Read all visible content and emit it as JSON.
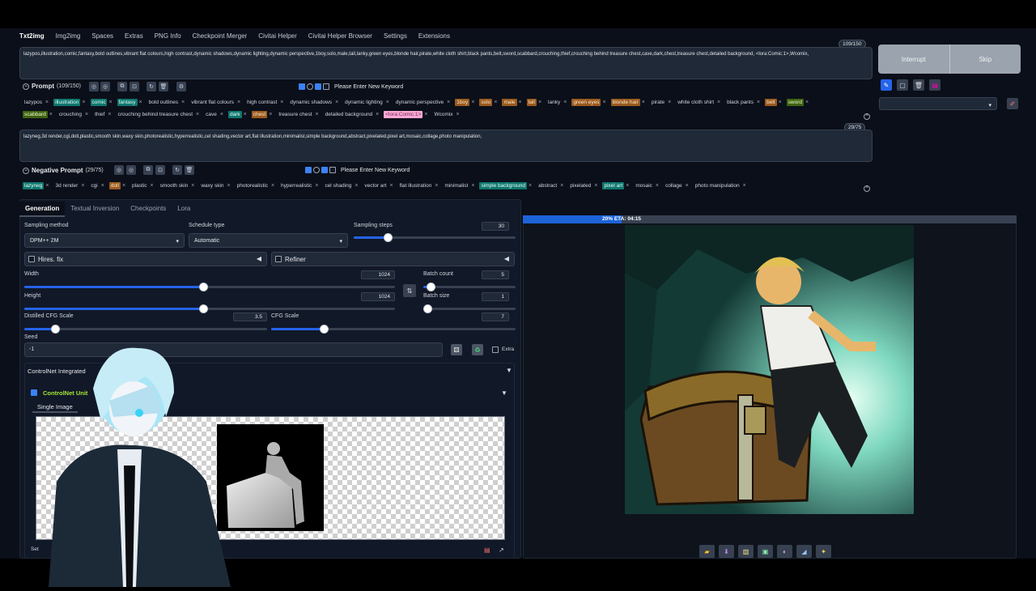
{
  "tabs": [
    "Txt2img",
    "Img2img",
    "Spaces",
    "Extras",
    "PNG Info",
    "Checkpoint Merger",
    "Civitai Helper",
    "Civitai Helper Browser",
    "Settings",
    "Extensions"
  ],
  "prompt": {
    "text": "lazypos,illustration,comic,fantasy,bold outlines,vibrant flat colours,high contrast,dynamic shadows,dynamic lighting,dynamic perspective,1boy,solo,male,tall,lanky,green eyes,blonde hair,pirate,white cloth shirt,black pants,belt,sword,scabbard,crouching,thief,crouching behind treasure chest,cave,dark,chest,treasure chest,detailed background, <lora:Comic:1>,Wcomix,",
    "counter": "109/150",
    "label": "Prompt",
    "count": "(109/150)",
    "keyword_label": "Please Enter New Keyword"
  },
  "prompt_tags": [
    {
      "t": "lazypos",
      "c": "plain"
    },
    {
      "t": "illustration",
      "c": "teal"
    },
    {
      "t": "comic",
      "c": "teal"
    },
    {
      "t": "fantasy",
      "c": "teal"
    },
    {
      "t": "bold outlines",
      "c": "plain"
    },
    {
      "t": "vibrant flat colours",
      "c": "plain"
    },
    {
      "t": "high contrast",
      "c": "plain"
    },
    {
      "t": "dynamic shadows",
      "c": "plain"
    },
    {
      "t": "dynamic lighting",
      "c": "plain"
    },
    {
      "t": "dynamic perspective",
      "c": "plain"
    },
    {
      "t": "1boy",
      "c": "orange"
    },
    {
      "t": "solo",
      "c": "orange"
    },
    {
      "t": "male",
      "c": "orange"
    },
    {
      "t": "tall",
      "c": "orange"
    },
    {
      "t": "lanky",
      "c": "plain"
    },
    {
      "t": "green eyes",
      "c": "orange"
    },
    {
      "t": "blonde hair",
      "c": "orange"
    },
    {
      "t": "pirate",
      "c": "plain"
    },
    {
      "t": "white cloth shirt",
      "c": "plain"
    },
    {
      "t": "black pants",
      "c": "plain"
    },
    {
      "t": "belt",
      "c": "orange"
    },
    {
      "t": "sword",
      "c": "green"
    }
  ],
  "prompt_tags2": [
    {
      "t": "scabbard",
      "c": "green"
    },
    {
      "t": "crouching",
      "c": "plain"
    },
    {
      "t": "thief",
      "c": "plain"
    },
    {
      "t": "crouching behind treasure chest",
      "c": "plain"
    },
    {
      "t": "cave",
      "c": "plain"
    },
    {
      "t": "dark",
      "c": "teal"
    },
    {
      "t": "chest",
      "c": "orange"
    },
    {
      "t": "treasure chest",
      "c": "plain"
    },
    {
      "t": "detailed background",
      "c": "plain"
    },
    {
      "t": "<lora:Comic:1>",
      "c": "pink"
    },
    {
      "t": "Wcomix",
      "c": "plain"
    }
  ],
  "negative": {
    "text": "lazyneg,3d render,cgi,doll,plastic,smooth skin,waxy skin,photorealistic,hyperrealistic,cel shading,vector art,flat illustration,minimalist,simple background,abstract,pixelated,pixel art,mosaic,collage,photo manipulation,",
    "counter": "29/75",
    "label": "Negative Prompt",
    "count": "(29/75)",
    "keyword_label": "Please Enter New Keyword"
  },
  "negative_tags": [
    {
      "t": "lazyneg",
      "c": "teal"
    },
    {
      "t": "3d render",
      "c": "plain"
    },
    {
      "t": "cgi",
      "c": "plain"
    },
    {
      "t": "doll",
      "c": "orange"
    },
    {
      "t": "plastic",
      "c": "plain"
    },
    {
      "t": "smooth skin",
      "c": "plain"
    },
    {
      "t": "waxy skin",
      "c": "plain"
    },
    {
      "t": "photorealistic",
      "c": "plain"
    },
    {
      "t": "hyperrealistic",
      "c": "plain"
    },
    {
      "t": "cel shading",
      "c": "plain"
    },
    {
      "t": "vector art",
      "c": "plain"
    },
    {
      "t": "flat illustration",
      "c": "plain"
    },
    {
      "t": "minimalist",
      "c": "plain"
    },
    {
      "t": "simple background",
      "c": "teal"
    },
    {
      "t": "abstract",
      "c": "plain"
    },
    {
      "t": "pixelated",
      "c": "plain"
    },
    {
      "t": "pixel art",
      "c": "teal"
    },
    {
      "t": "mosaic",
      "c": "plain"
    },
    {
      "t": "collage",
      "c": "plain"
    },
    {
      "t": "photo manipulation",
      "c": "plain"
    }
  ],
  "actions": {
    "interrupt": "Interrupt",
    "skip": "Skip"
  },
  "subtabs": [
    "Generation",
    "Textual Inversion",
    "Checkpoints",
    "Lora"
  ],
  "gen": {
    "sampling_method_label": "Sampling method",
    "sampling_method": "DPM++ 2M",
    "schedule_type_label": "Schedule type",
    "schedule_type": "Automatic",
    "sampling_steps_label": "Sampling steps",
    "sampling_steps": "30",
    "hires": "Hires. fix",
    "refiner": "Refiner",
    "width_label": "Width",
    "width": "1024",
    "height_label": "Height",
    "height": "1024",
    "batch_count_label": "Batch count",
    "batch_count": "5",
    "batch_size_label": "Batch size",
    "batch_size": "1",
    "dcfg_label": "Distilled CFG Scale",
    "dcfg": "3.5",
    "cfg_label": "CFG Scale",
    "cfg": "7",
    "seed_label": "Seed",
    "seed": "-1",
    "extra": "Extra",
    "controlnet": "ControlNet Integrated",
    "controlnet_unit": "ControlNet Unit",
    "single_image": "Single Image",
    "set_label": "Set"
  },
  "progress": {
    "text": "20% ETA: 04:15",
    "fraction": 0.2
  },
  "colors": {
    "accent": "#2563eb",
    "bg": "#0b0f19",
    "panel": "#111827"
  }
}
